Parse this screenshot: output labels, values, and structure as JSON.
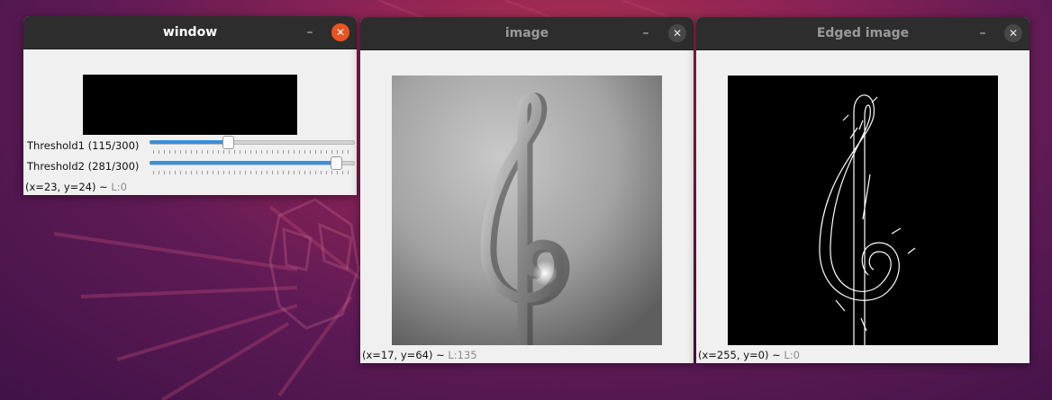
{
  "windows": {
    "control": {
      "title": "window",
      "minimize_glyph": "–",
      "close_glyph": "✕",
      "threshold1": {
        "label": "Threshold1 (115/300)",
        "value": 115,
        "max": 300
      },
      "threshold2": {
        "label": "Threshold2 (281/300)",
        "value": 281,
        "max": 300
      },
      "status": {
        "coords": "(x=23, y=24) ~ ",
        "level": "L:0"
      }
    },
    "image": {
      "title": "image",
      "minimize_glyph": "–",
      "close_glyph": "✕",
      "status": {
        "coords": "(x=17, y=64) ~ ",
        "level": "L:135"
      }
    },
    "edged": {
      "title": "Edged image",
      "minimize_glyph": "–",
      "close_glyph": "✕",
      "status": {
        "coords": "(x=255, y=0) ~ ",
        "level": "L:0"
      }
    }
  },
  "colors": {
    "active_close": "#e95420",
    "slider_fill": "#3a8fd8",
    "titlebar": "#2d2d2d"
  },
  "icons": {
    "minimize": "minimize-icon",
    "close": "close-icon"
  }
}
